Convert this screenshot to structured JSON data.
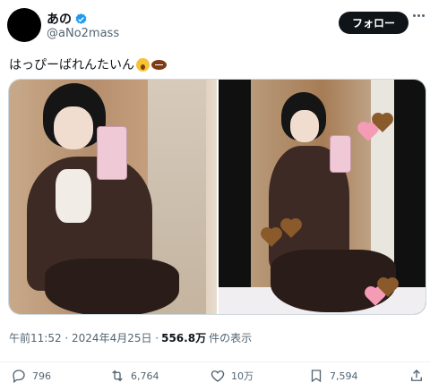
{
  "author": {
    "name": "あの",
    "handle": "@aNo2mass"
  },
  "follow_label": "フォロー",
  "tweet": {
    "text": "はっぴーばれんたいん"
  },
  "meta": {
    "time_date": "午前11:52 · 2024年4月25日 ·",
    "views": "556.8万",
    "views_suffix": "件の表示"
  },
  "actions": {
    "replies": "796",
    "retweets": "6,764",
    "likes": "10万",
    "bookmarks": "7,594"
  },
  "icons": [
    "verified-badge-icon",
    "more-icon",
    "astonished-emoji-icon",
    "football-emoji-icon",
    "reply-icon",
    "retweet-icon",
    "like-icon",
    "bookmark-icon",
    "share-icon"
  ],
  "colors": {
    "accent": "#1d9bf0",
    "text": "#0f1419",
    "muted": "#536471",
    "follow_bg": "#0f1419"
  }
}
